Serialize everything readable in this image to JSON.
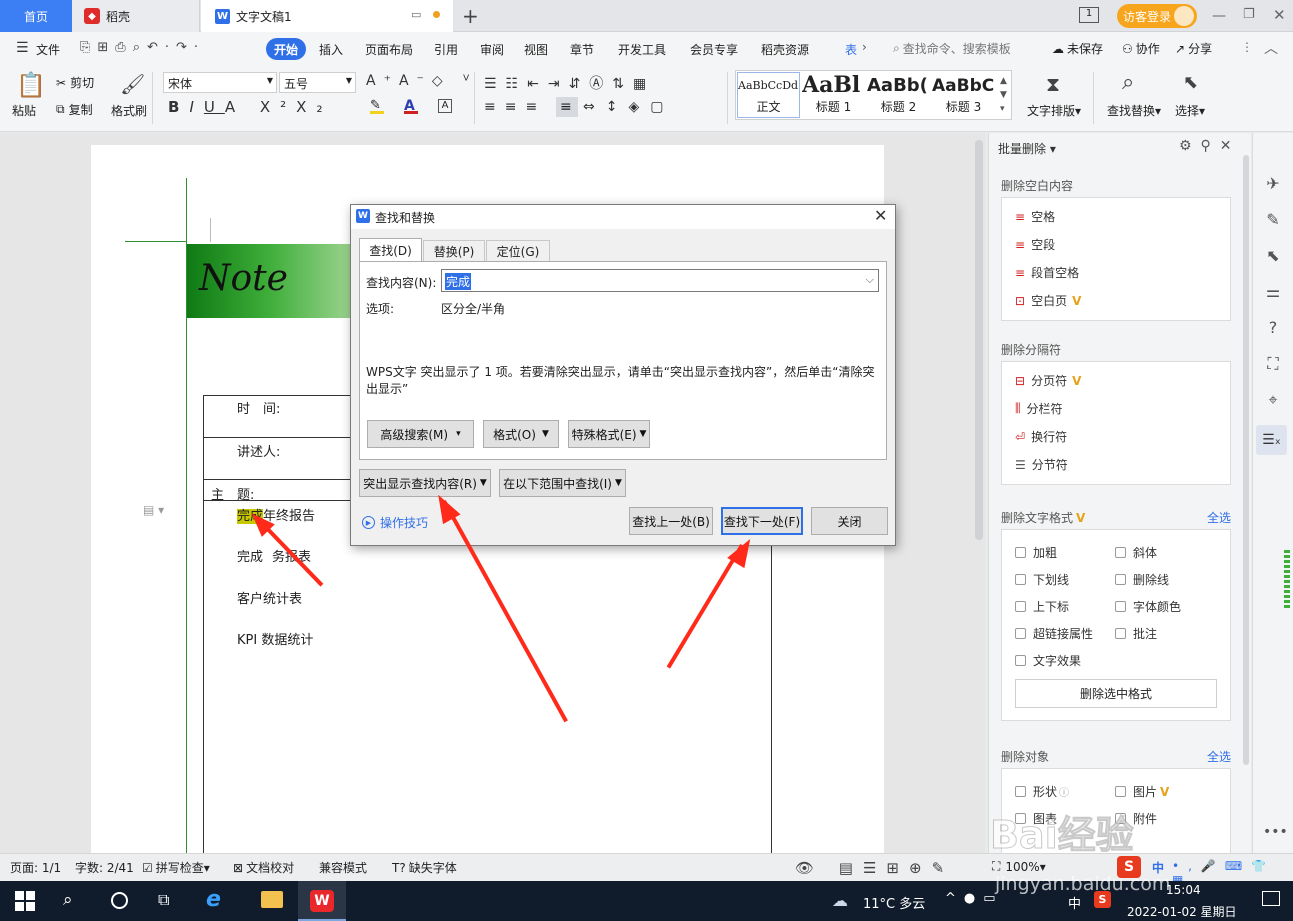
{
  "titlebar": {
    "home_tab": "首页",
    "daoke_tab": "稻壳",
    "doc_tab": "文字文稿1",
    "new_tab": "+",
    "login_label": "访客登录"
  },
  "menubar": {
    "file": "文件",
    "items": [
      "开始",
      "插入",
      "页面布局",
      "引用",
      "审阅",
      "视图",
      "章节",
      "开发工具",
      "会员专享",
      "稻壳资源",
      "表"
    ],
    "search_placeholder": "查找命令、搜索模板",
    "unsaved": "未保存",
    "collab": "协作",
    "share": "分享"
  },
  "toolbar": {
    "paste": "粘贴",
    "cut": "剪切",
    "copy": "复制",
    "format_painter": "格式刷",
    "font_name": "宋体",
    "font_size": "五号",
    "styles": [
      {
        "sample": "AaBbCcDd",
        "name": "正文"
      },
      {
        "sample": "AaBl",
        "name": "标题 1"
      },
      {
        "sample": "AaBb(",
        "name": "标题 2"
      },
      {
        "sample": "AaBbC",
        "name": "标题 3"
      }
    ],
    "text_layout": "文字排版",
    "find_replace": "查找替换",
    "select": "选择"
  },
  "document": {
    "banner_text": "Note",
    "row_time": "时　间:",
    "row_speaker": "讲述人:",
    "row_topic": "主　题:",
    "items": [
      "年终报告",
      "完成财务报表",
      "客户统计表",
      "KPI 数据统计"
    ],
    "highlight_word": "完成",
    "item2_visible": "完成",
    "item2_tail": "务报表",
    "item3_visible": "客户统计表"
  },
  "dialog": {
    "title": "查找和替换",
    "tabs": [
      "查找(D)",
      "替换(P)",
      "定位(G)"
    ],
    "find_label": "查找内容(N):",
    "find_value": "完成",
    "options_label": "选项:",
    "options_value": "区分全/半角",
    "message": "WPS文字 突出显示了 1 项。若要清除突出显示，请单击“突出显示查找内容”，然后单击“清除突出显示”",
    "btn_advanced": "高级搜索(M)",
    "btn_format": "格式(O)",
    "btn_special": "特殊格式(E)",
    "btn_highlight": "突出显示查找内容(R)",
    "btn_scope": "在以下范围中查找(I)",
    "tips_link": "操作技巧",
    "btn_prev": "查找上一处(B)",
    "btn_next": "查找下一处(F)",
    "btn_close": "关闭"
  },
  "panel": {
    "title": "批量删除",
    "sec1_title": "删除空白内容",
    "sec1_items": [
      "空格",
      "空段",
      "段首空格",
      "空白页"
    ],
    "sec2_title": "删除分隔符",
    "sec2_items": [
      "分页符",
      "分栏符",
      "换行符",
      "分节符"
    ],
    "sec3_title": "删除文字格式",
    "select_all": "全选",
    "sec3_items": [
      "加粗",
      "斜体",
      "下划线",
      "删除线",
      "上下标",
      "字体颜色",
      "超链接属性",
      "批注",
      "文字效果"
    ],
    "delete_btn": "删除选中格式",
    "sec4_title": "删除对象",
    "sec4_items": [
      "形状",
      "图片",
      "图表",
      "附件"
    ]
  },
  "statusbar": {
    "page": "页面: 1/1",
    "words": "字数: 2/41",
    "spell": "拼写检查",
    "proof": "文档校对",
    "compat": "兼容模式",
    "missing_font": "缺失字体",
    "zoom": "100%",
    "ime": "中"
  },
  "taskbar": {
    "weather": "11°C 多云",
    "ime": "中",
    "time": "15:04",
    "date": "2022-01-02 星期日"
  },
  "watermark": {
    "text": "Bai经验",
    "url": "jingyan.baidu.com"
  },
  "colors": {
    "accent_blue": "#2f6fe8",
    "banner_green": "#1e8a1e",
    "highlight": "#c8c800",
    "annotation_red": "#ff2a1a",
    "vip_gold": "#e5a21a"
  }
}
